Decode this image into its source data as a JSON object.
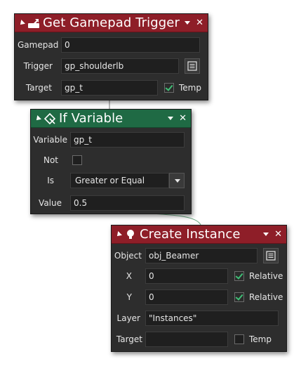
{
  "get_gamepad_trigger": {
    "title": "Get Gamepad Trigger",
    "icon": "gamepad-trigger-icon",
    "header_color": "#8e1e28",
    "gamepad_label": "Gamepad",
    "gamepad_value": "0",
    "trigger_label": "Trigger",
    "trigger_value": "gp_shoulderlb",
    "target_label": "Target",
    "target_value": "gp_t",
    "temp_label": "Temp",
    "temp_checked": true
  },
  "if_variable": {
    "title": "If Variable",
    "icon": "condition-icon",
    "header_color": "#1f6a44",
    "variable_label": "Variable",
    "variable_value": "gp_t",
    "not_label": "Not",
    "not_checked": false,
    "is_label": "Is",
    "is_value": "Greater or Equal",
    "value_label": "Value",
    "value_value": "0.5"
  },
  "create_instance": {
    "title": "Create Instance",
    "icon": "lightbulb-icon",
    "header_color": "#8e1e28",
    "object_label": "Object",
    "object_value": "obj_Beamer",
    "x_label": "X",
    "x_value": "0",
    "x_relative_label": "Relative",
    "x_relative_checked": true,
    "y_label": "Y",
    "y_value": "0",
    "y_relative_label": "Relative",
    "y_relative_checked": true,
    "layer_label": "Layer",
    "layer_value": "\"Instances\"",
    "target_label": "Target",
    "target_value": "",
    "temp_label": "Temp",
    "temp_checked": false
  }
}
